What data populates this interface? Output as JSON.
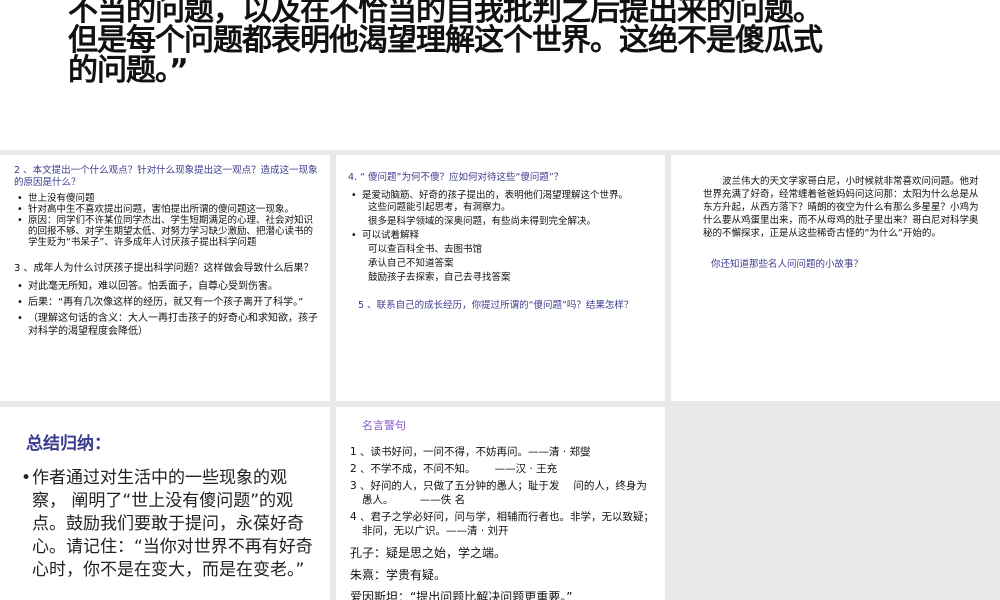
{
  "top_slide": {
    "lines": [
      "不当的问题，以及在不恰当的自我批判之后提出来的问题。",
      "但是每个问题都表明他渴望理解这个世界。这绝不是傻瓜式",
      "的问题。”"
    ]
  },
  "slide1": {
    "q2": "2 、本文提出一个什么观点？针对什么现象提出这一观点？造成这一现象的原因是什么？",
    "q2_bullets": [
      "世上没有傻问题",
      "针对高中生不喜欢提出问题，害怕提出所谓的傻问题这一现象。",
      "原因：同学们不许某位同学杰出、学生短期满足的心理、社会对知识的回报不够、对学生期望太低、对努力学习缺少激励、把潜心读书的学生贬为“书呆子”、许多成年人讨厌孩子提出科学问题"
    ],
    "q3": "3 、成年人为什么讨厌孩子提出科学问题？这样做会导致什么后果？",
    "q3_bullets": [
      "对此毫无所知，难以回答。怕丢面子，自尊心受到伤害。",
      "后果：“再有几次像这样的经历，就又有一个孩子离开了科学。”",
      "（理解这句话的含义：大人一再打击孩子的好奇心和求知欲，孩子对科学的渴望程度会降低）"
    ]
  },
  "slide2": {
    "q4": "4. “ 傻问题”为何不傻？应如何对待这些“傻问题”？",
    "b1": "是爱动脑筋、好奇的孩子提出的，表明他们渴望理解这个世界。",
    "b1_sub": [
      "这些问题能引起思考，有洞察力。",
      "很多是科学领域的深奥问题，有些尚未得到完全解决。"
    ],
    "b2": "可以试着解释",
    "b2_sub": [
      "可以查百科全书、去图书馆",
      "承认自己不知道答案",
      "鼓励孩子去探索，自己去寻找答案"
    ],
    "q5": "5 、联系自己的成长经历，你提过所谓的“傻问题”吗？结果怎样？"
  },
  "slide3": {
    "story": "波兰伟大的天文学家哥白尼，小时候就非常喜欢问问题。他对世界充满了好奇，经常缠着爸爸妈妈问这问那：太阳为什么总是从东方升起，从西方落下？晴朗的夜空为什么有那么多星星？小鸡为什么要从鸡蛋里出来，而不从母鸡的肚子里出来？哥白尼对科学奥秘的不懈探求，正是从这些稀奇古怪的“为什么”开始的。",
    "question": "你还知道那些名人问问题的小故事？"
  },
  "slide4": {
    "title": "总结归纳：",
    "bullet": "作者通过对生活中的一些现象的观察， 阐明了“世上没有傻问题”的观点。鼓励我们要敢于提问，永葆好奇心。请记住：“当你对世界不再有好奇心时，你不是在变大，而是在变老。”"
  },
  "slide5": {
    "title": "名言警句",
    "quotes": [
      "1 、读书好问，一问不得，不妨再问。——清 · 郑燮",
      "2 、不学不成，不问不知。　　 ——汉 · 王充",
      "3 、好问的人，只做了五分钟的愚人；耻于发　 问的人，终身为愚人。　　　——佚 名",
      "4 、君子之学必好问，问与学，相辅而行者也。非学，无以致疑；非问，无以广识。——清 · 刘开"
    ],
    "sayings": [
      "孔子：疑是思之始，学之端。",
      "朱熹：学贵有疑。",
      "爱因斯坦：“提出问题比解决问题更重要。”"
    ]
  },
  "colors": {
    "title_blue": "#3b3b8f",
    "purple": "#8a5cc8",
    "background": "#e9e9e9"
  }
}
